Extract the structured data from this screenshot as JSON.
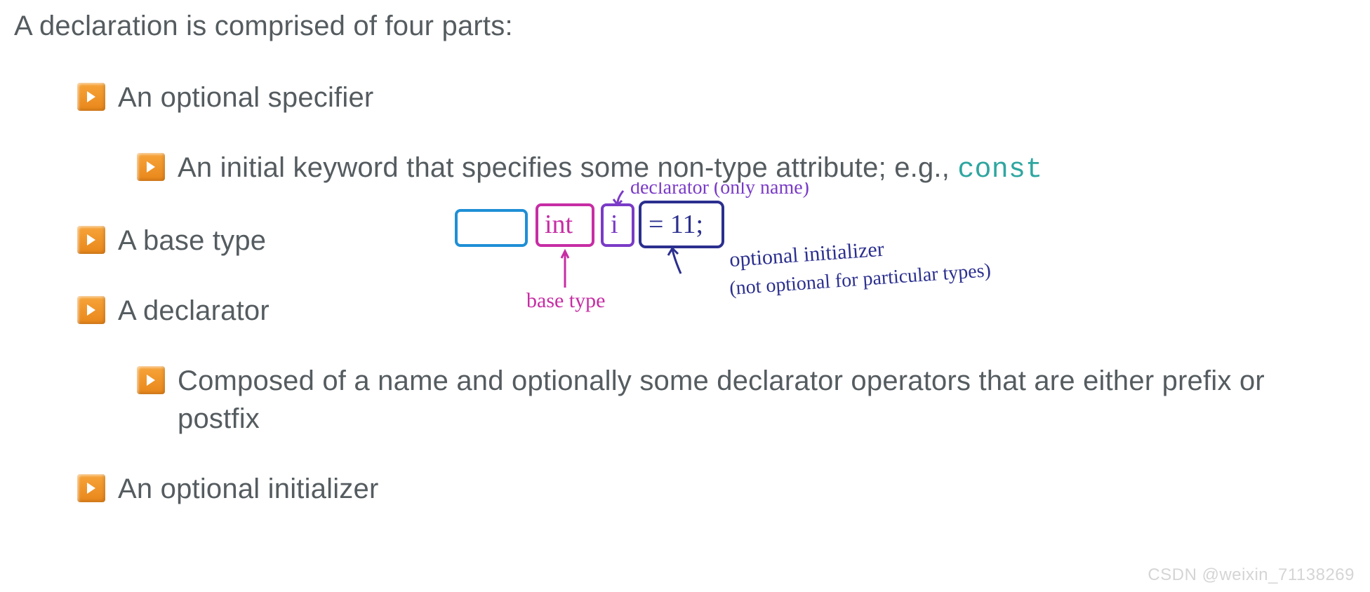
{
  "intro": "A declaration is comprised of four parts:",
  "items": {
    "specifier": "An optional specifier",
    "specifier_sub_a": "An initial keyword that specifies some non-type attribute; e.g., ",
    "specifier_sub_code": "const",
    "base_type": "A base type",
    "declarator": "A declarator",
    "declarator_sub": "Composed of a name and optionally some declarator operators that are either prefix or postfix",
    "initializer": "An optional initializer"
  },
  "annotation": {
    "box_int": "int",
    "box_i": "i",
    "box_eq": "= 11;",
    "label_base_type": "base type",
    "label_declarator": "declarator (only name)",
    "label_initializer_1": "optional initializer",
    "label_initializer_2": "(not optional for particular types)"
  },
  "watermark": "CSDN @weixin_71138269"
}
